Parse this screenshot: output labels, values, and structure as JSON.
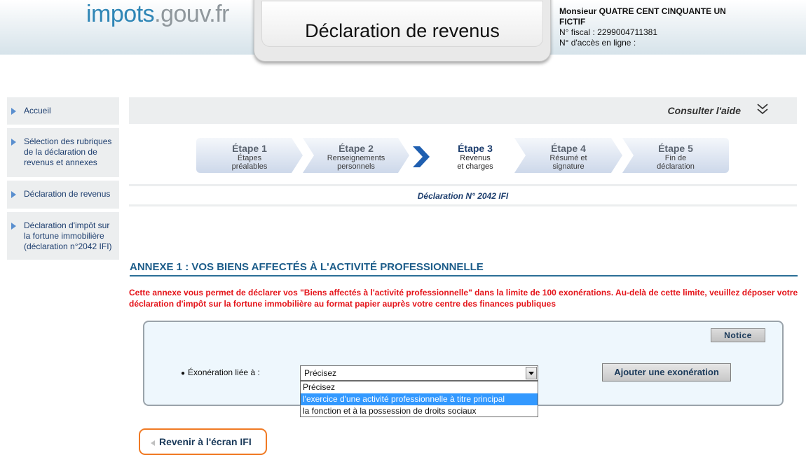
{
  "header": {
    "logo_part1": "impots",
    "logo_part2": ".gouv.fr",
    "title": "Déclaration de revenus",
    "user_name": "Monsieur QUATRE CENT CINQUANTE UN FICTIF",
    "fiscal_number": "N° fiscal : 2299004711381",
    "access_number": "N° d'accès en ligne :"
  },
  "sidebar": {
    "items": [
      {
        "label": "Accueil"
      },
      {
        "label": "Sélection des rubriques de la déclaration de revenus et annexes"
      },
      {
        "label": "Déclaration de revenus"
      },
      {
        "label": "Déclaration d'impôt sur la fortune immobilière (déclaration n°2042 IFI)"
      }
    ]
  },
  "help": {
    "label": "Consulter l'aide"
  },
  "steps": [
    {
      "title": "Étape 1",
      "line1": "Étapes",
      "line2": "préalables"
    },
    {
      "title": "Étape 2",
      "line1": "Renseignements",
      "line2": "personnels"
    },
    {
      "title": "Étape 3",
      "line1": "Revenus",
      "line2": "et charges"
    },
    {
      "title": "Étape 4",
      "line1": "Résumé et",
      "line2": "signature"
    },
    {
      "title": "Étape 5",
      "line1": "Fin de",
      "line2": "déclaration"
    }
  ],
  "declaration_label": "Déclaration N° 2042 IFI",
  "annex": {
    "title": "ANNEXE 1 : VOS BIENS AFFECTÉS À L'ACTIVITÉ PROFESSIONNELLE",
    "note": "Cette annexe vous permet de déclarer vos \"Biens affectés à l'activité professionnelle\" dans la limite de 100 exonérations. Au-delà de cette limite, veuillez déposer votre déclaration d'impôt sur la fortune immobilière au format papier auprès votre centre des finances publiques"
  },
  "form": {
    "notice_label": "Notice",
    "exo_label": "Éxonération liée à :",
    "select_value": "Précisez",
    "add_button": "Ajouter une exonération",
    "options": [
      "Précisez",
      "l'exercice d'une activité professionnelle à titre principal",
      "la fonction et à la possession de droits sociaux"
    ]
  },
  "back_button": "Revenir à l'écran IFI",
  "colors": {
    "accent_blue": "#1d5d8a",
    "warning_red": "#e4141a",
    "back_border": "#f07a24",
    "highlight": "#3399ff"
  }
}
